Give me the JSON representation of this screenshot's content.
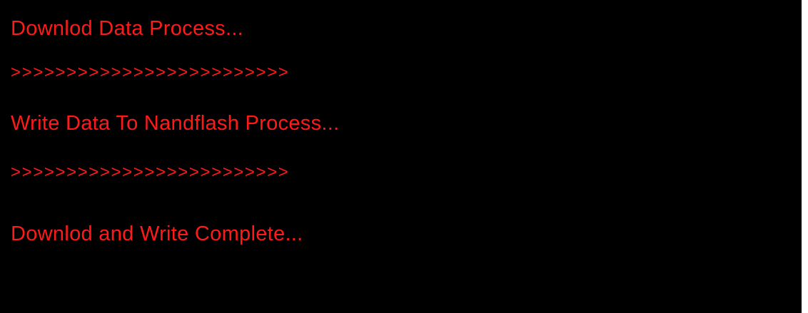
{
  "screen": {
    "text_color": "#ff1a1a",
    "background_color": "#000000",
    "lines": [
      {
        "text": "Downlod Data Process..."
      },
      {
        "text": ">>>>>>>>>>>>>>>>>>>>>>>>>"
      },
      {
        "text": "Write Data To Nandflash Process..."
      },
      {
        "text": ">>>>>>>>>>>>>>>>>>>>>>>>>"
      },
      {
        "text": "Downlod and Write Complete..."
      }
    ]
  }
}
